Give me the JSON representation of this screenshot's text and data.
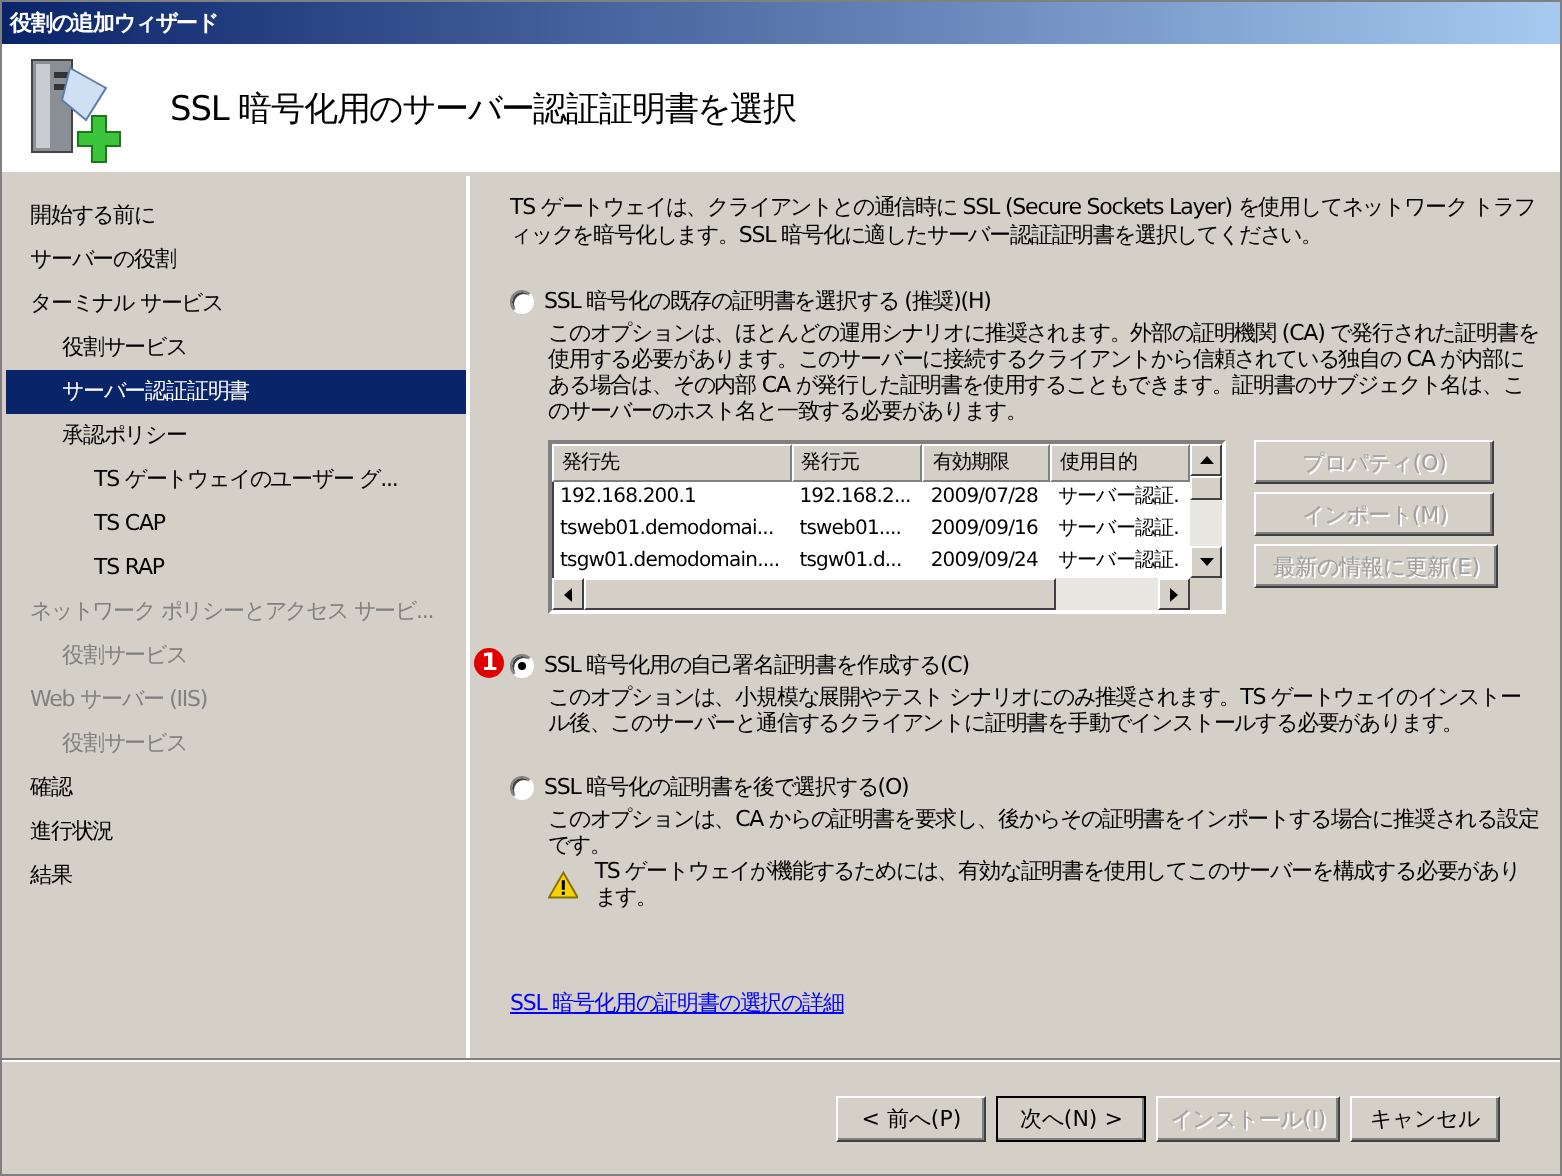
{
  "window": {
    "title": "役割の追加ウィザード"
  },
  "header": {
    "title": "SSL 暗号化用のサーバー認証証明書を選択"
  },
  "sidebar": {
    "items": [
      {
        "label": "開始する前に",
        "selected": false,
        "disabled": false
      },
      {
        "label": "サーバーの役割",
        "selected": false,
        "disabled": false
      },
      {
        "label": "ターミナル サービス",
        "selected": false,
        "disabled": false,
        "children": [
          {
            "label": "役割サービス",
            "selected": false,
            "disabled": false
          },
          {
            "label": "サーバー認証証明書",
            "selected": true,
            "disabled": false
          },
          {
            "label": "承認ポリシー",
            "selected": false,
            "disabled": false,
            "children": [
              {
                "label": "TS ゲートウェイのユーザー グ...",
                "selected": false,
                "disabled": false
              },
              {
                "label": "TS CAP",
                "selected": false,
                "disabled": false
              },
              {
                "label": "TS RAP",
                "selected": false,
                "disabled": false
              }
            ]
          }
        ]
      },
      {
        "label": "ネットワーク ポリシーとアクセス サービ...",
        "selected": false,
        "disabled": true,
        "children": [
          {
            "label": "役割サービス",
            "selected": false,
            "disabled": true
          }
        ]
      },
      {
        "label": "Web サーバー (IIS)",
        "selected": false,
        "disabled": true,
        "children": [
          {
            "label": "役割サービス",
            "selected": false,
            "disabled": true
          }
        ]
      },
      {
        "label": "確認",
        "selected": false,
        "disabled": false
      },
      {
        "label": "進行状況",
        "selected": false,
        "disabled": false
      },
      {
        "label": "結果",
        "selected": false,
        "disabled": false
      }
    ]
  },
  "intro": "TS ゲートウェイは、クライアントとの通信時に SSL (Secure Sockets Layer) を使用してネットワーク トラフィックを暗号化します。SSL 暗号化に適したサーバー認証証明書を選択してください。",
  "options": [
    {
      "label": "SSL 暗号化の既存の証明書を選択する (推奨)(H)",
      "selected": false,
      "description": "このオプションは、ほとんどの運用シナリオに推奨されます。外部の証明機関 (CA) で発行された証明書を使用する必要があります。このサーバーに接続するクライアントから信頼されている独自の CA が内部にある場合は、その内部 CA が発行した証明書を使用することもできます。証明書のサブジェクト名は、このサーバーのホスト名と一致する必要があります。",
      "table": {
        "columns": [
          "発行先",
          "発行元",
          "有効期限",
          "使用目的"
        ],
        "rows": [
          [
            "192.168.200.1",
            "192.168.2...",
            "2009/07/28",
            "サーバー認証."
          ],
          [
            "tsweb01.demodomai...",
            "tsweb01....",
            "2009/09/16",
            "サーバー認証."
          ],
          [
            "tsgw01.demodomain....",
            "tsgw01.d...",
            "2009/09/24",
            "サーバー認証."
          ]
        ]
      },
      "buttons": [
        {
          "label": "プロパティ(O)",
          "disabled": true
        },
        {
          "label": "インポート(M)",
          "disabled": true
        },
        {
          "label": "最新の情報に更新(E)",
          "disabled": true
        }
      ]
    },
    {
      "label": "SSL 暗号化用の自己署名証明書を作成する(C)",
      "selected": true,
      "badge": "1",
      "description": "このオプションは、小規模な展開やテスト シナリオにのみ推奨されます。TS ゲートウェイのインストール後、このサーバーと通信するクライアントに証明書を手動でインストールする必要があります。"
    },
    {
      "label": "SSL 暗号化の証明書を後で選択する(O)",
      "selected": false,
      "description": "このオプションは、CA からの証明書を要求し、後からその証明書をインポートする場合に推奨される設定です。",
      "warning": "TS ゲートウェイが機能するためには、有効な証明書を使用してこのサーバーを構成する必要があります。"
    }
  ],
  "link": "SSL 暗号化用の証明書の選択の詳細",
  "footer_buttons": [
    {
      "label": "< 前へ(P)",
      "disabled": false,
      "default": false
    },
    {
      "label": "次へ(N) >",
      "disabled": false,
      "default": true
    },
    {
      "label": "インストール(I)",
      "disabled": true,
      "default": false
    },
    {
      "label": "キャンセル",
      "disabled": false,
      "default": false
    }
  ]
}
